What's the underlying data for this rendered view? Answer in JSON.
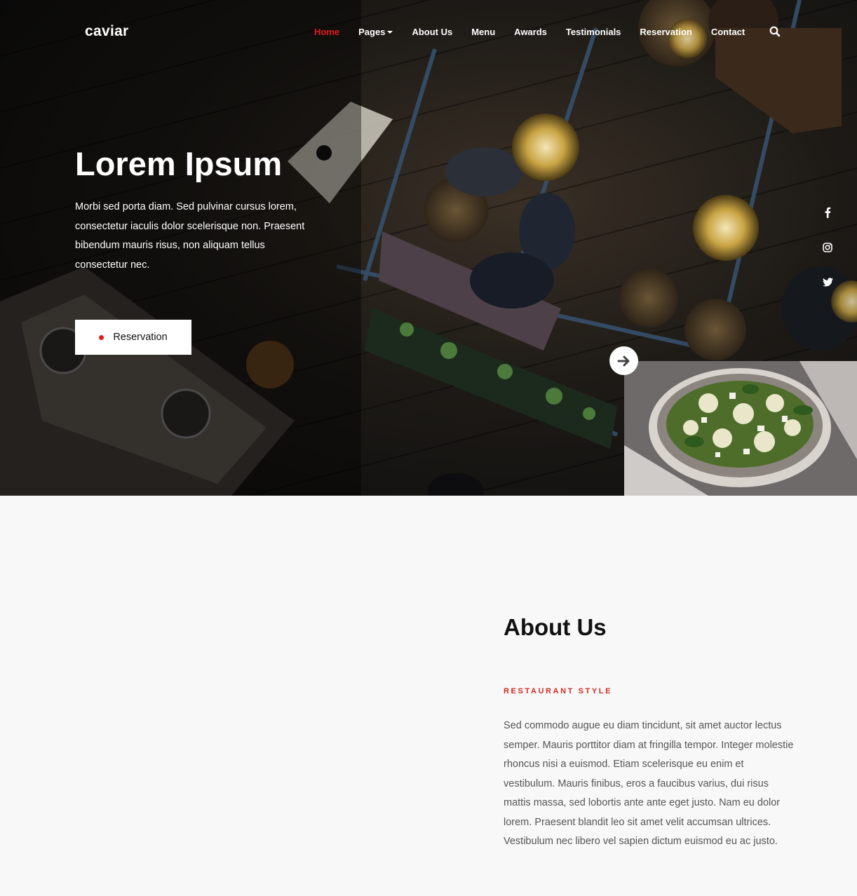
{
  "brand": {
    "name": "caviar"
  },
  "nav": {
    "items": [
      {
        "label": "Home",
        "active": true
      },
      {
        "label": "Pages",
        "dropdown": true
      },
      {
        "label": "About Us"
      },
      {
        "label": "Menu"
      },
      {
        "label": "Awards"
      },
      {
        "label": "Testimonials"
      },
      {
        "label": "Reservation"
      },
      {
        "label": "Contact"
      }
    ],
    "search_icon": "search-icon"
  },
  "hero": {
    "title": "Lorem Ipsum",
    "text": "Morbi sed porta diam. Sed pulvinar cursus lorem, consectetur iaculis dolor scelerisque non. Praesent bibendum mauris risus, non aliquam tellus consectetur nec.",
    "button_label": "Reservation",
    "next_icon": "arrow-right-icon"
  },
  "social": [
    "facebook-icon",
    "instagram-icon",
    "twitter-icon"
  ],
  "about": {
    "title": "About Us",
    "kicker": "RESTAURANT STYLE",
    "text": "Sed commodo augue eu diam tincidunt, sit amet auctor lectus semper. Mauris porttitor diam at fringilla tempor. Integer molestie rhoncus nisi a euismod. Etiam scelerisque eu enim et vestibulum. Mauris finibus, eros a faucibus varius, dui risus mattis massa, sed lobortis ante ante eget justo. Nam eu dolor lorem. Praesent blandit leo sit amet velit accumsan ultrices. Vestibulum nec libero vel sapien dictum euismod eu ac justo."
  },
  "colors": {
    "accent": "#e21b1b",
    "kicker": "#d42a22",
    "page_bg": "#f8f8f8",
    "hero_bg": "#1d1a16"
  }
}
